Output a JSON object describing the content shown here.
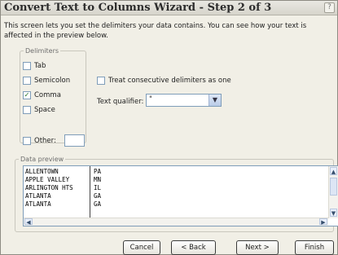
{
  "window": {
    "title": "Convert Text to Columns Wizard - Step 2 of 3",
    "help_label": "?"
  },
  "intro": "This screen lets you set the delimiters your data contains.  You can see how your text is affected in the preview below.",
  "delimiters": {
    "legend": "Delimiters",
    "tab": {
      "label": "Tab",
      "checked": false
    },
    "semicolon": {
      "label": "Semicolon",
      "checked": false
    },
    "comma": {
      "label": "Comma",
      "checked": true
    },
    "space": {
      "label": "Space",
      "checked": false
    },
    "other": {
      "label": "Other:",
      "checked": false,
      "value": ""
    }
  },
  "treat_consecutive": {
    "label": "Treat consecutive delimiters as one",
    "checked": false
  },
  "text_qualifier": {
    "label": "Text qualifier:",
    "value": "\""
  },
  "preview": {
    "legend": "Data preview",
    "rows": [
      [
        "ALLENTOWN",
        "PA"
      ],
      [
        "APPLE VALLEY",
        "MN"
      ],
      [
        "ARLINGTON HTS",
        "IL"
      ],
      [
        "ATLANTA",
        "GA"
      ],
      [
        "ATLANTA",
        "GA"
      ]
    ]
  },
  "buttons": {
    "cancel": "Cancel",
    "back": "< Back",
    "next": "Next >",
    "finish": "Finish"
  },
  "check_glyph": "✓"
}
